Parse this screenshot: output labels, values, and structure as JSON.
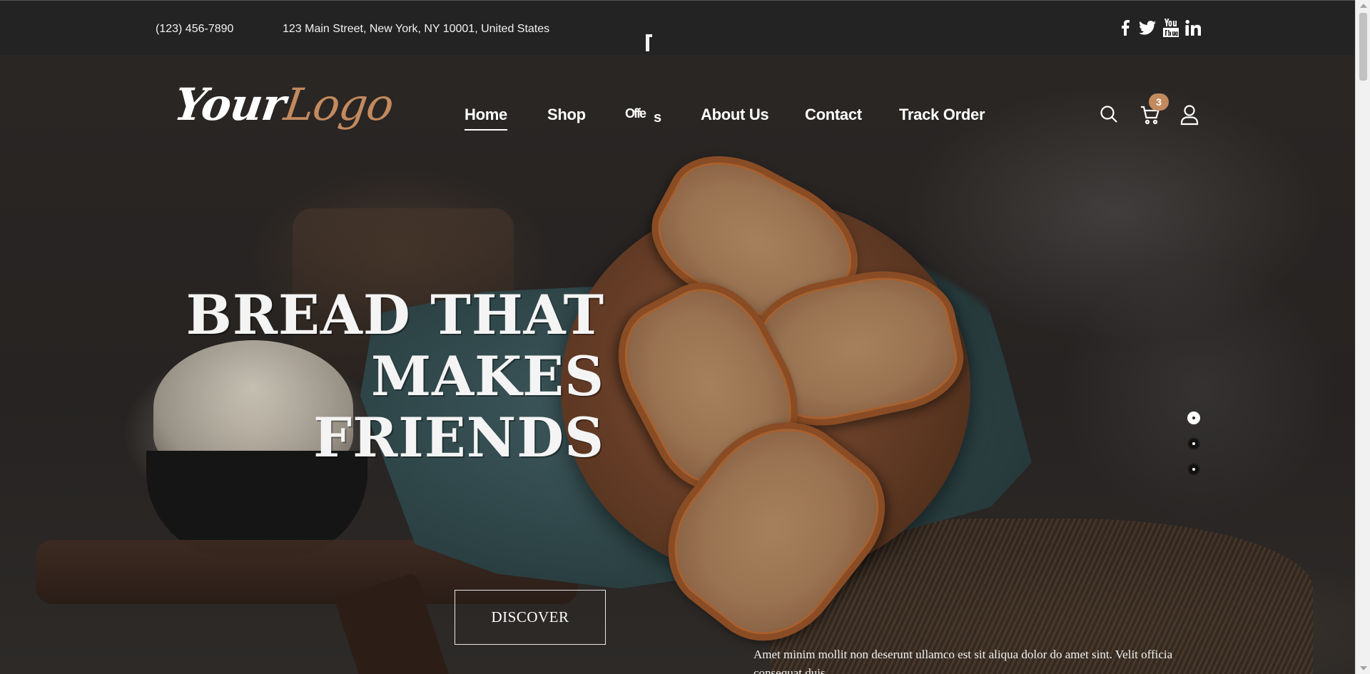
{
  "topbar": {
    "phone": "(123) 456-7890",
    "address": "123 Main Street, New York, NY 10001, United States",
    "social": [
      {
        "icon": "facebook-icon"
      },
      {
        "icon": "twitter-icon"
      },
      {
        "icon": "youtube-icon"
      },
      {
        "icon": "linkedin-icon"
      }
    ]
  },
  "header": {
    "logo": {
      "part1": "Your",
      "part2": "Logo"
    },
    "nav": [
      {
        "label": "Home",
        "active": true
      },
      {
        "label": "Shop"
      },
      {
        "label": "Offe",
        "label_tail": "s"
      },
      {
        "label": "About Us"
      },
      {
        "label": "Contact"
      },
      {
        "label": "Track Order"
      }
    ],
    "cart_count": "3",
    "icons": [
      "search-icon",
      "cart-icon",
      "user-icon"
    ]
  },
  "hero": {
    "headline": [
      "BREAD THAT",
      "MAKES",
      "FRIENDS"
    ],
    "cta": "DISCOVER",
    "slides": 3,
    "active_slide": 1,
    "paragraph": "Amet minim mollit non deserunt ullamco est sit aliqua dolor do amet sint. Velit officia consequat duis"
  },
  "colors": {
    "accent": "#c28a5e",
    "topbar_bg": "#232323",
    "text": "#ffffff"
  }
}
